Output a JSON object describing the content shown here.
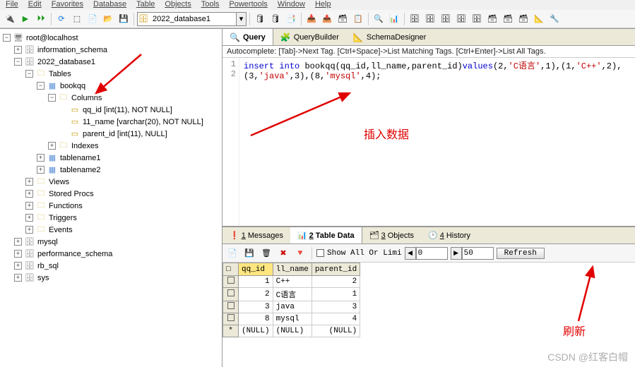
{
  "menubar": [
    "File",
    "Edit",
    "Favorites",
    "Database",
    "Table",
    "Objects",
    "Tools",
    "Powertools",
    "Window",
    "Help"
  ],
  "db_selector": {
    "value": "2022_database1"
  },
  "tree": {
    "root": "root@localhost",
    "dbs": [
      {
        "name": "information_schema",
        "open": false
      },
      {
        "name": "2022_database1",
        "open": true,
        "children": {
          "tables": {
            "label": "Tables",
            "open": true,
            "items": [
              {
                "name": "bookqq",
                "open": true,
                "columns": {
                  "label": "Columns",
                  "open": true,
                  "cols": [
                    {
                      "label": "qq_id [int(11), NOT NULL]"
                    },
                    {
                      "label": "11_name [varchar(20), NOT NULL]"
                    },
                    {
                      "label": "parent_id [int(11), NULL]"
                    }
                  ]
                },
                "indexes": {
                  "label": "Indexes"
                }
              },
              {
                "name": "tablename1"
              },
              {
                "name": "tablename2"
              }
            ]
          },
          "views": {
            "label": "Views"
          },
          "procs": {
            "label": "Stored Procs"
          },
          "functions": {
            "label": "Functions"
          },
          "triggers": {
            "label": "Triggers"
          },
          "events": {
            "label": "Events"
          }
        }
      },
      {
        "name": "mysql",
        "open": false
      },
      {
        "name": "performance_schema",
        "open": false
      },
      {
        "name": "rb_sql",
        "open": false
      },
      {
        "name": "sys",
        "open": false
      }
    ]
  },
  "qtabs": [
    {
      "label": "Query",
      "icon": "🔍",
      "active": true
    },
    {
      "label": "QueryBuilder",
      "icon": "🧩"
    },
    {
      "label": "SchemaDesigner",
      "icon": "📐"
    }
  ],
  "autocomplete": "Autocomplete: [Tab]->Next Tag. [Ctrl+Space]->List Matching Tags. [Ctrl+Enter]->List All Tags.",
  "sql": {
    "lines": [
      "1",
      "2"
    ],
    "tokens": [
      [
        {
          "t": "insert ",
          "c": "kw"
        },
        {
          "t": "into ",
          "c": "kw"
        },
        {
          "t": "bookqq",
          "c": "fn"
        },
        {
          "t": "(",
          "c": "pa"
        },
        {
          "t": "qq_id",
          "c": "fn"
        },
        {
          "t": ",",
          "c": "pa"
        },
        {
          "t": "ll_name",
          "c": "fn"
        },
        {
          "t": ",",
          "c": "pa"
        },
        {
          "t": "parent_id",
          "c": "fn"
        },
        {
          "t": ")",
          "c": "pa"
        },
        {
          "t": "values",
          "c": "kw"
        },
        {
          "t": "(",
          "c": "pa"
        },
        {
          "t": "2",
          "c": "num"
        },
        {
          "t": ",",
          "c": "pa"
        },
        {
          "t": "'C语言'",
          "c": "str"
        },
        {
          "t": ",",
          "c": "pa"
        },
        {
          "t": "1",
          "c": "num"
        },
        {
          "t": ")",
          "c": "pa"
        },
        {
          "t": ",",
          "c": "pa"
        },
        {
          "t": "(",
          "c": "pa"
        },
        {
          "t": "1",
          "c": "num"
        },
        {
          "t": ",",
          "c": "pa"
        },
        {
          "t": "'C++'",
          "c": "str"
        },
        {
          "t": ",",
          "c": "pa"
        },
        {
          "t": "2",
          "c": "num"
        },
        {
          "t": ")",
          "c": "pa"
        },
        {
          "t": ",",
          "c": "pa"
        }
      ],
      [
        {
          "t": "(",
          "c": "pa"
        },
        {
          "t": "3",
          "c": "num"
        },
        {
          "t": ",",
          "c": "pa"
        },
        {
          "t": "'java'",
          "c": "str"
        },
        {
          "t": ",",
          "c": "pa"
        },
        {
          "t": "3",
          "c": "num"
        },
        {
          "t": ")",
          "c": "pa"
        },
        {
          "t": ",",
          "c": "pa"
        },
        {
          "t": "(",
          "c": "pa"
        },
        {
          "t": "8",
          "c": "num"
        },
        {
          "t": ",",
          "c": "pa"
        },
        {
          "t": "'mysql'",
          "c": "str"
        },
        {
          "t": ",",
          "c": "pa"
        },
        {
          "t": "4",
          "c": "num"
        },
        {
          "t": ")",
          "c": "pa"
        },
        {
          "t": ";",
          "c": "pa"
        }
      ]
    ]
  },
  "annotation_insert": "插入数据",
  "annotation_refresh": "刷新",
  "btabs": [
    {
      "label": "1 Messages",
      "u": "1",
      "rest": " Messages",
      "icon": "❗"
    },
    {
      "label": "2 Table Data",
      "u": "2",
      "rest": " Table Data",
      "icon": "📊",
      "active": true
    },
    {
      "label": "3 Objects",
      "u": "3",
      "rest": " Objects",
      "icon": "🗂"
    },
    {
      "label": "4 History",
      "u": "4",
      "rest": " History",
      "icon": "🕑"
    }
  ],
  "paging": {
    "showall": "Show All Or Limi",
    "from": "0",
    "to": "50",
    "refresh": "Refresh"
  },
  "tabledata": {
    "cols": [
      "qq_id",
      "ll_name",
      "parent_id"
    ],
    "selcol": 0,
    "rows": [
      {
        "h": "□",
        "c": [
          "1",
          "C++",
          "2"
        ]
      },
      {
        "h": "□",
        "c": [
          "2",
          "C语言",
          "1"
        ]
      },
      {
        "h": "□",
        "c": [
          "3",
          "java",
          "3"
        ]
      },
      {
        "h": "□",
        "c": [
          "8",
          "mysql",
          "4"
        ]
      },
      {
        "h": "*",
        "c": [
          "(NULL)",
          "(NULL)",
          "(NULL)"
        ]
      }
    ]
  },
  "watermark": "CSDN @红客白帽"
}
